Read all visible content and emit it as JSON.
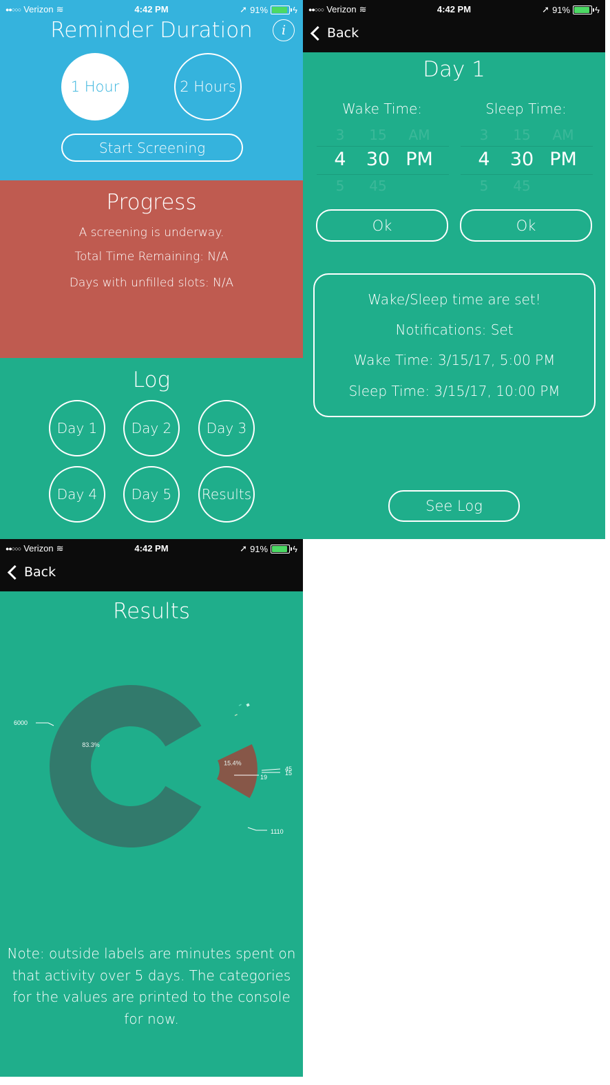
{
  "status_bar": {
    "carrier": "Verizon",
    "time": "4:42 PM",
    "battery": "91%",
    "battery_level": 0.91
  },
  "home": {
    "title": "Reminder Duration",
    "info_label": "i",
    "durations": [
      "1 Hour",
      "2 Hours"
    ],
    "selected_duration": "1 Hour",
    "start_button": "Start Screening",
    "progress": {
      "title": "Progress",
      "lines": [
        "A screening is underway.",
        "Total Time Remaining: N/A",
        "Days with unfilled slots: N/A"
      ]
    },
    "log": {
      "title": "Log",
      "buttons": [
        "Day 1",
        "Day 2",
        "Day 3",
        "Day 4",
        "Day 5",
        "Results"
      ]
    }
  },
  "day_screen": {
    "back_label": "Back",
    "title": "Day 1",
    "wake_label": "Wake Time:",
    "sleep_label": "Sleep Time:",
    "picker_above": {
      "hour": "3",
      "minute": "15",
      "period": "AM"
    },
    "picker_selected": {
      "hour": "4",
      "minute": "30",
      "period": "PM"
    },
    "picker_below": {
      "hour": "5",
      "minute": "45",
      "period": ""
    },
    "ok_label": "Ok",
    "status_lines": [
      "Wake/Sleep time are set!",
      "Notifications: Set",
      "Wake Time: 3/15/17, 5:00 PM",
      "Sleep Time: 3/15/17, 10:00 PM"
    ],
    "see_log": "See Log"
  },
  "results_screen": {
    "back_label": "Back",
    "title": "Results",
    "note": "Note: outside labels are minutes spent on that activity over 5 days. The categories for the values are printed to the console for now."
  },
  "chart_data": {
    "type": "pie",
    "style": "donut",
    "slices": [
      {
        "value": 6000,
        "label": "6000",
        "percent_label": "83.3%",
        "color": "#327a6c"
      },
      {
        "value": 15,
        "label": "15",
        "percent_label": "",
        "color": "#53d6b5"
      },
      {
        "value": 45,
        "label": "45",
        "percent_label": "",
        "color": "#c8f3e6"
      },
      {
        "value": 19,
        "label": "19",
        "percent_label": "",
        "color": "#bfe0bd"
      },
      {
        "value": 1110,
        "label": "1110",
        "percent_label": "15.4%",
        "color": "#875748"
      }
    ],
    "legend": "none"
  },
  "colors": {
    "blue": "#35b3dd",
    "red": "#bf5b50",
    "green": "#1fae8b",
    "navbar": "#0c0c0c"
  }
}
